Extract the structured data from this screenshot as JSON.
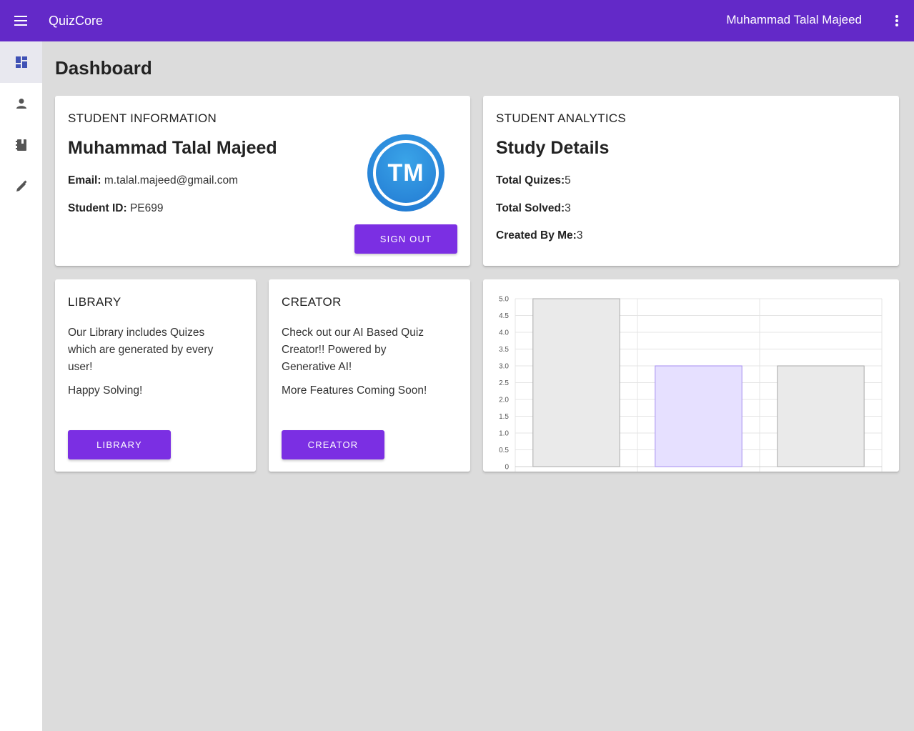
{
  "app": {
    "title": "QuizCore",
    "user_name": "Muhammad Talal Majeed",
    "accent": "#6329c8",
    "button_color": "#7b2fe3"
  },
  "sidebar": {
    "items": [
      {
        "icon": "dashboard-icon",
        "active": true
      },
      {
        "icon": "person-icon",
        "active": false
      },
      {
        "icon": "book-icon",
        "active": false
      },
      {
        "icon": "pen-icon",
        "active": false
      }
    ]
  },
  "page": {
    "title": "Dashboard"
  },
  "student_info": {
    "overline": "STUDENT INFORMATION",
    "name": "Muhammad Talal Majeed",
    "email_label": "Email:",
    "email": "m.talal.majeed@gmail.com",
    "id_label": "Student ID:",
    "id": "PE699",
    "avatar_initials": "TM",
    "sign_out_label": "SIGN OUT"
  },
  "analytics": {
    "overline": "STUDENT ANALYTICS",
    "heading": "Study Details",
    "total_quizes_label": "Total Quizes:",
    "total_quizes": "5",
    "total_solved_label": "Total Solved:",
    "total_solved": "3",
    "created_label": "Created By Me:",
    "created": "3"
  },
  "library": {
    "overline": "LIBRARY",
    "line1": "Our Library includes Quizes",
    "line2": "which are generated by every",
    "line3": "user!",
    "line4": "Happy Solving!",
    "button": "LIBRARY"
  },
  "creator": {
    "overline": "CREATOR",
    "line1": "Check out our AI Based Quiz",
    "line2": "Creator!! Powered by",
    "line3": "Generative AI!",
    "line4": "More Features Coming Soon!",
    "button": "CREATOR"
  },
  "chart_data": {
    "type": "bar",
    "categories": [
      "",
      "",
      ""
    ],
    "values": [
      5,
      3,
      3
    ],
    "ylim": [
      0,
      5
    ],
    "yticks": [
      "0",
      "0.5",
      "1.0",
      "1.5",
      "2.0",
      "2.5",
      "3.0",
      "3.5",
      "4.0",
      "4.5",
      "5.0"
    ],
    "grid": true,
    "bar_fills": [
      "#eaeaea",
      "#e6e0ff",
      "#eaeaea"
    ],
    "bar_strokes": [
      "#aaaaaa",
      "#a58ef0",
      "#aaaaaa"
    ]
  }
}
